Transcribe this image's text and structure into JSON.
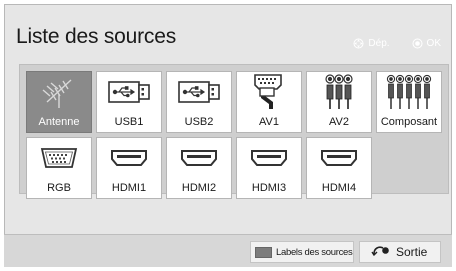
{
  "window": {
    "title": "Liste des sources"
  },
  "nav_hint": {
    "move_label": "Dép.",
    "ok_label": "OK",
    "move_icon": "dpad-arrows-icon",
    "ok_icon": "ok-circle-icon"
  },
  "sources": [
    {
      "label": "Antenne",
      "icon": "antenna-icon",
      "selected": true
    },
    {
      "label": "USB1",
      "icon": "usb-icon",
      "selected": false
    },
    {
      "label": "USB2",
      "icon": "usb-icon",
      "selected": false
    },
    {
      "label": "AV1",
      "icon": "scart-icon",
      "selected": false
    },
    {
      "label": "AV2",
      "icon": "rca-3-plug-icon",
      "selected": false
    },
    {
      "label": "Composant",
      "icon": "rca-5-plug-icon",
      "selected": false
    },
    {
      "label": "RGB",
      "icon": "vga-port-icon",
      "selected": false
    },
    {
      "label": "HDMI1",
      "icon": "hdmi-port-icon",
      "selected": false
    },
    {
      "label": "HDMI2",
      "icon": "hdmi-port-icon",
      "selected": false
    },
    {
      "label": "HDMI3",
      "icon": "hdmi-port-icon",
      "selected": false
    },
    {
      "label": "HDMI4",
      "icon": "hdmi-port-icon",
      "selected": false
    }
  ],
  "footer": {
    "labels_button": "Labels des sources",
    "labels_swatch_color": "#7c7c7c",
    "exit_button": "Sortie",
    "exit_icon": "return-arrow-icon"
  },
  "colors": {
    "selected_tile": "#8a8a8a",
    "tile": "#ffffff",
    "panel": "#e6e6e6"
  }
}
